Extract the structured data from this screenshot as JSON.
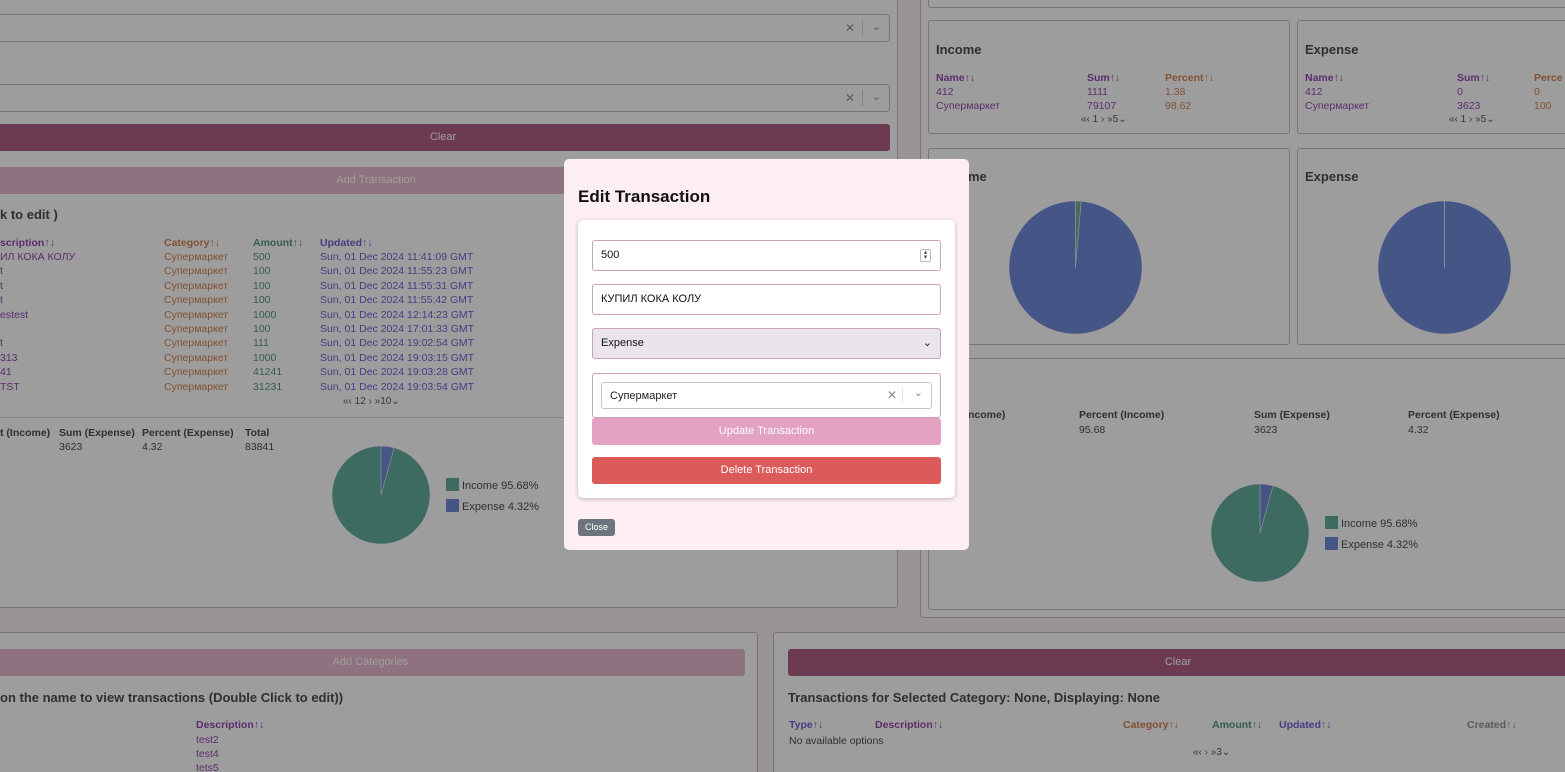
{
  "filters": {
    "clear_label": "Clear",
    "add_transaction_label": "Add Transaction"
  },
  "transactions": {
    "heading": "k to edit )",
    "columns": [
      "scription↑↓",
      "Category↑↓",
      "Amount↑↓",
      "Updated↑↓"
    ],
    "rows": [
      [
        "ИЛ КОКА КОЛУ",
        "Супермаркет",
        "500",
        "Sun, 01 Dec 2024 11:41:09 GMT"
      ],
      [
        "t",
        "Супермаркет",
        "100",
        "Sun, 01 Dec 2024 11:55:23 GMT"
      ],
      [
        "t",
        "Супермаркет",
        "100",
        "Sun, 01 Dec 2024 11:55:31 GMT"
      ],
      [
        "t",
        "Супермаркет",
        "100",
        "Sun, 01 Dec 2024 11:55:42 GMT"
      ],
      [
        "estest",
        "Супермаркет",
        "1000",
        "Sun, 01 Dec 2024 12:14:23 GMT"
      ],
      [
        "",
        "Супермаркет",
        "100",
        "Sun, 01 Dec 2024 17:01:33 GMT"
      ],
      [
        "t",
        "Супермаркет",
        "111",
        "Sun, 01 Dec 2024 19:02:54 GMT"
      ],
      [
        "313",
        "Супермаркет",
        "1000",
        "Sun, 01 Dec 2024 19:03:15 GMT"
      ],
      [
        "41",
        "Супермаркет",
        "41241",
        "Sun, 01 Dec 2024 19:03:28 GMT"
      ],
      [
        "TST",
        "Супермаркет",
        "31231",
        "Sun, 01 Dec 2024 19:03:54 GMT"
      ]
    ],
    "pager": "«‹ 12 › »10⌄"
  },
  "summary_left": {
    "headers": [
      "t (Income)",
      "Sum (Expense)",
      "Percent (Expense)",
      "Total"
    ],
    "values": [
      "",
      "3623",
      "4.32",
      "83841"
    ],
    "legend": [
      {
        "label": "Income 95.68%",
        "color": "#3f9a86"
      },
      {
        "label": "Expense 4.32%",
        "color": "#4f6fcf"
      }
    ]
  },
  "income_table": {
    "title": "Income",
    "columns": [
      "Name↑↓",
      "Sum↑↓",
      "Percent↑↓"
    ],
    "rows": [
      [
        "412",
        "1111",
        "1.38"
      ],
      [
        "Супермаркет",
        "79107",
        "98.62"
      ]
    ],
    "pager": "«‹ 1 › »5⌄"
  },
  "expense_table": {
    "title": "Expense",
    "columns": [
      "Name↑↓",
      "Sum↑↓",
      "Perce"
    ],
    "rows": [
      [
        "412",
        "0",
        "0"
      ],
      [
        "Супермаркет",
        "3623",
        "100"
      ]
    ],
    "pager": "«‹ 1 › »5⌄"
  },
  "income_pie_title": "me",
  "expense_pie_title": "Expense",
  "summary_right": {
    "headers": [
      "ncome)",
      "Percent (Income)",
      "Sum (Expense)",
      "Percent (Expense)"
    ],
    "values": [
      "",
      "95.68",
      "3623",
      "4.32"
    ],
    "legend": [
      {
        "label": "Income 95.68%",
        "color": "#3f9a86"
      },
      {
        "label": "Expense 4.32%",
        "color": "#4f6fcf"
      }
    ]
  },
  "categories": {
    "add_label": "Add Categories",
    "heading": "on the name to view transactions (Double Click to edit))",
    "column": "Description↑↓",
    "items": [
      "test2",
      "test4",
      "tets5"
    ]
  },
  "selected_category": {
    "clear_label": "Clear",
    "heading": "Transactions for Selected Category: None, Displaying: None",
    "columns": [
      "Type↑↓",
      "Description↑↓",
      "Category↑↓",
      "Amount↑↓",
      "Updated↑↓",
      "Created↑↓"
    ],
    "empty": "No available options",
    "pager": "«‹ › »3⌄"
  },
  "modal": {
    "title": "Edit Transaction",
    "amount": "500",
    "description": "КУПИЛ КОКА КОЛУ",
    "type": "Expense",
    "category": "Супермаркет",
    "update_label": "Update Transaction",
    "delete_label": "Delete Transaction",
    "close_label": "Close"
  }
}
